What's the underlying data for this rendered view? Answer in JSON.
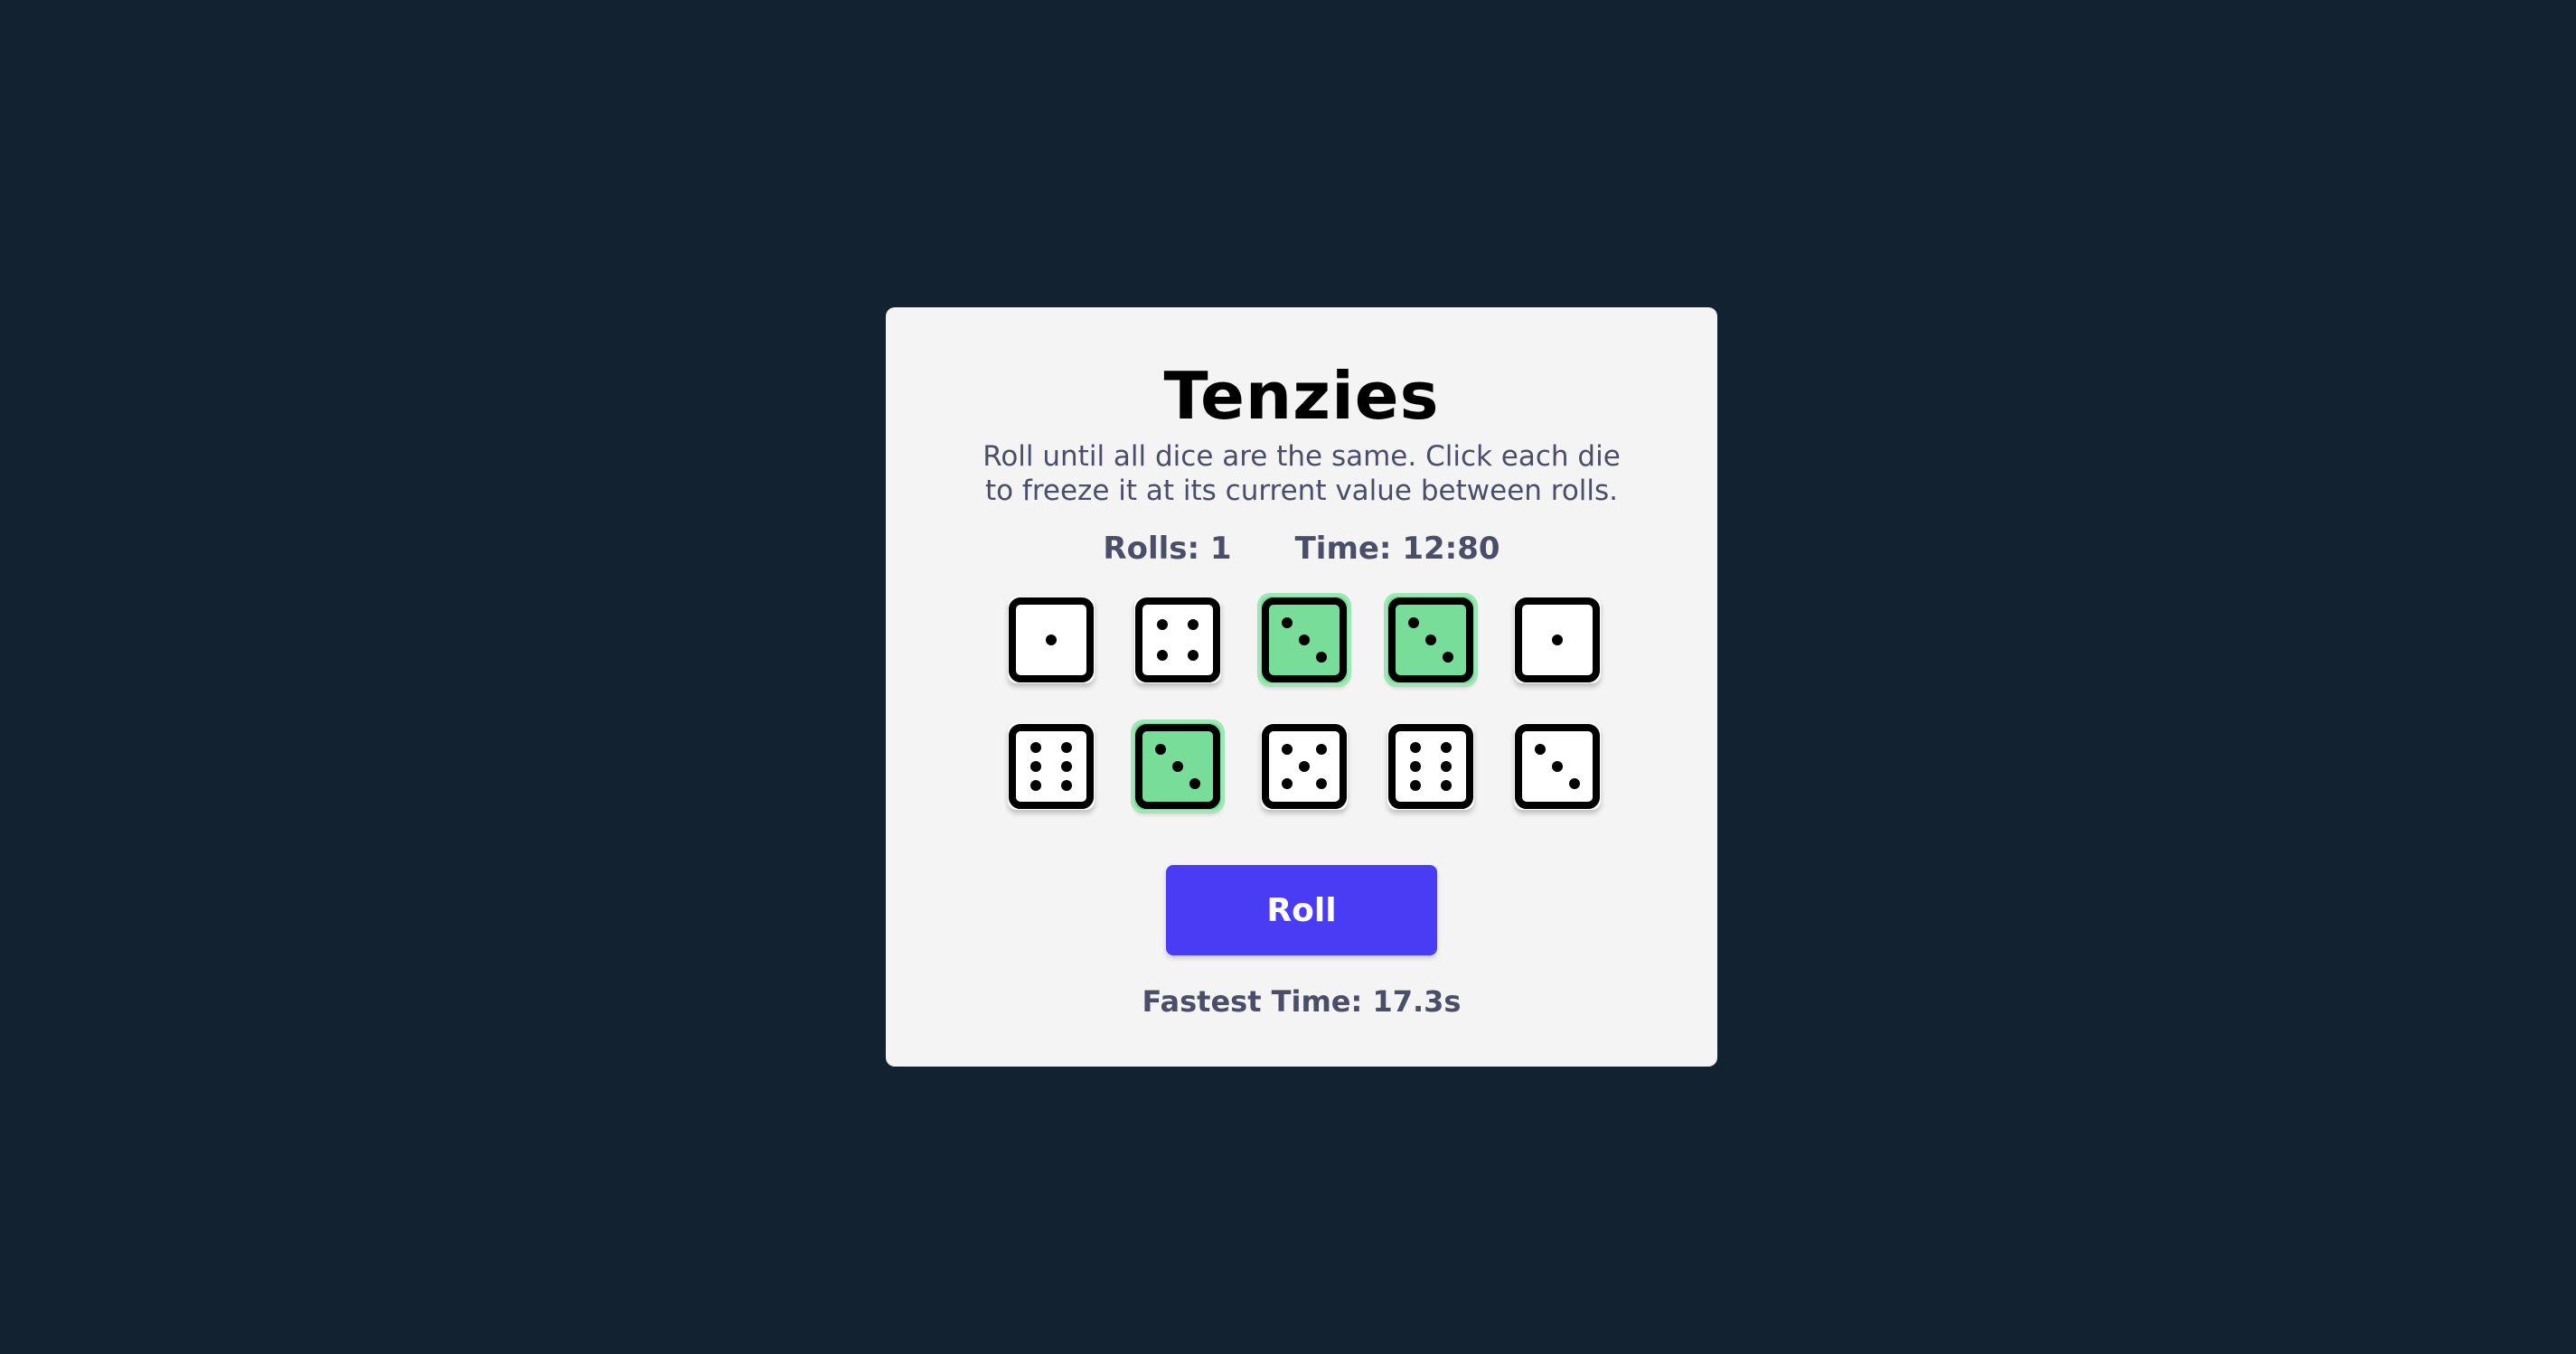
{
  "game": {
    "title": "Tenzies",
    "instructions": "Roll until all dice are the same. Click each die to freeze it at its current value between rolls.",
    "rolls_label": "Rolls: 1",
    "time_label": "Time: 12:80",
    "roll_button_label": "Roll",
    "fastest_time_label": "Fastest Time: 17.3s"
  },
  "dice": [
    {
      "value": 1,
      "held": false
    },
    {
      "value": 4,
      "held": false
    },
    {
      "value": 3,
      "held": true
    },
    {
      "value": 3,
      "held": true
    },
    {
      "value": 1,
      "held": false
    },
    {
      "value": 6,
      "held": false
    },
    {
      "value": 3,
      "held": true
    },
    {
      "value": 5,
      "held": false
    },
    {
      "value": 6,
      "held": false
    },
    {
      "value": 3,
      "held": false
    }
  ],
  "colors": {
    "background": "#132231",
    "card": "#f4f4f4",
    "held_die": "#77dd98",
    "roll_button": "#4a3cf4",
    "muted_text": "#4a4e69"
  }
}
